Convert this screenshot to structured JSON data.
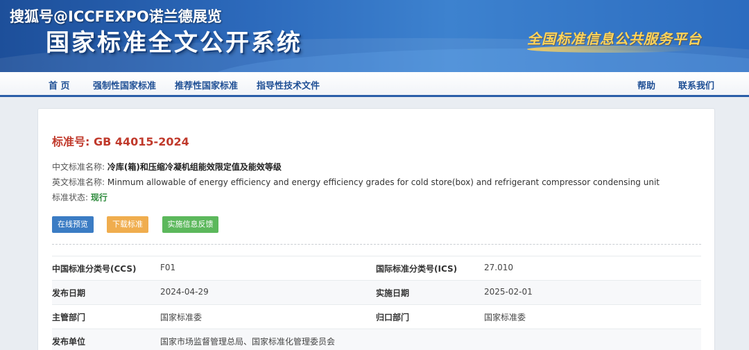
{
  "watermark": "搜狐号@ICCFEXPO诺兰德展览",
  "site": {
    "title": "国家标准全文公开系统",
    "platform": "全国标准信息公共服务平台"
  },
  "nav": {
    "home": "首 页",
    "mandatory": "强制性国家标准",
    "recommended": "推荐性国家标准",
    "guidance": "指导性技术文件",
    "help": "帮助",
    "contact": "联系我们"
  },
  "standard": {
    "number_label": "标准号:",
    "number": "GB 44015-2024",
    "cn_name_label": "中文标准名称:",
    "cn_name": "冷库(箱)和压缩冷凝机组能效限定值及能效等级",
    "en_name_label": "英文标准名称:",
    "en_name": "Minmum allowable of energy efficiency and energy efficiency grades for cold store(box) and refrigerant compressor condensing unit",
    "status_label": "标准状态:",
    "status": "现行"
  },
  "buttons": {
    "preview": "在线预览",
    "download": "下载标准",
    "feedback": "实施信息反馈"
  },
  "info": [
    {
      "label1": "中国标准分类号(CCS)",
      "value1": "F01",
      "label2": "国际标准分类号(ICS)",
      "value2": "27.010"
    },
    {
      "label1": "发布日期",
      "value1": "2024-04-29",
      "label2": "实施日期",
      "value2": "2025-02-01"
    },
    {
      "label1": "主管部门",
      "value1": "国家标准委",
      "label2": "归口部门",
      "value2": "国家标准委"
    },
    {
      "label1": "发布单位",
      "value1": "国家市场监督管理总局、国家标准化管理委员会",
      "label2": "",
      "value2": ""
    }
  ],
  "colors": {
    "accent": "#2a5ea8",
    "std_number": "#c0392b",
    "status": "#2e8b3d",
    "btn_preview": "#3b7cc4",
    "btn_download": "#f0ad4e",
    "btn_feedback": "#5cb85c"
  }
}
